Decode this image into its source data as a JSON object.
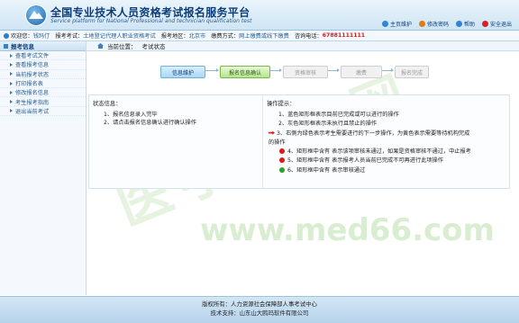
{
  "header": {
    "title": "全国专业技术人员资格考试报名服务平台",
    "subtitle": "Service platform for National Professional and technician qualification test",
    "links": [
      {
        "label": "主页维护",
        "color": "#2f86d6"
      },
      {
        "label": "修改密码",
        "color": "#e07a16"
      },
      {
        "label": "帮助",
        "color": "#2f86d6"
      },
      {
        "label": "安全退出",
        "color": "#d82020"
      }
    ]
  },
  "infobar": {
    "welcome_label": "欢迎您：",
    "user": "钱玛仃",
    "exam_label": "报考考试：",
    "exam": "土地登记代理人职业资格考试",
    "region_label": "报考地区：",
    "region": "北京市",
    "fee_label": "缴费方式：",
    "fee": "网上缴费或线下缴费",
    "phone_label": "咨询电话：",
    "phone": "67881111111"
  },
  "sidebar": {
    "heading": "报考信息",
    "items": [
      {
        "label": "查看考试文件"
      },
      {
        "label": "查看报考信息"
      },
      {
        "label": "当前报考状态"
      },
      {
        "label": "打印报名表"
      },
      {
        "label": "修改报名信息"
      },
      {
        "label": "考生报考指南"
      },
      {
        "label": "退出当前考试"
      }
    ]
  },
  "breadcrumb": {
    "label": "当前位置：",
    "page": "考试状态"
  },
  "steps": [
    {
      "label": "信息维护",
      "state": "done"
    },
    {
      "label": "报名信息确认",
      "state": "current"
    },
    {
      "label": "资格审核",
      "state": "todo"
    },
    {
      "label": "缴费",
      "state": "todo"
    },
    {
      "label": "报名完成",
      "state": "todo"
    }
  ],
  "status": {
    "heading": "状态信息：",
    "lines": [
      "1、报名信息录入完毕",
      "2、请点击报名信息确认进行确认操作"
    ]
  },
  "tips": {
    "heading": "操作提示：",
    "lines": [
      "1、蓝色矩形框表示目前已完成或可以进行的操作",
      "2、灰色矩形框表示未执行且禁止的操作",
      "3、右侧为绿色表示考生需要进行的下一步操作，为黄色表示需要等待机构完成",
      "的操作",
      "4、矩形框中含有 表示该项审核未通过，如果是资格审核不通过，中止报考",
      "5、矩形框中含有 表示报考人员当前已完成不可再进行此项操作",
      "6、矩形框中含有 表示审核通过"
    ]
  },
  "watermark": {
    "cn": "医学教育网",
    "url": "www.med66.com"
  },
  "footer": {
    "copyright": "版权所有：人力资源社会保障部人事考试中心",
    "support": "技术支持：山东山大鸥玛软件有限公司"
  },
  "colors": {
    "accent": "#0d3d78",
    "phone": "#e01818",
    "step_done": "#a9d8f5",
    "step_current": "#b7e58e",
    "step_todo": "#f1f1f1"
  }
}
